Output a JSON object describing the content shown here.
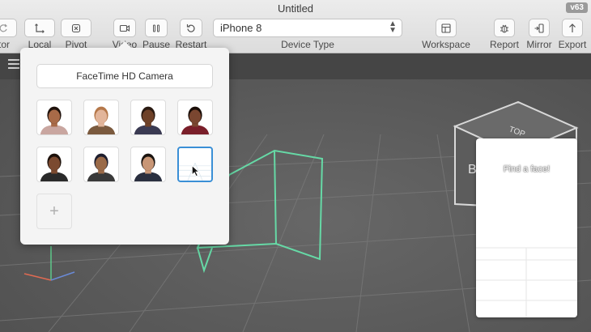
{
  "window": {
    "title": "Untitled",
    "version": "v63"
  },
  "toolbar": {
    "items": [
      {
        "label": "tor",
        "icon": "refresh-icon"
      },
      {
        "label": "Local",
        "icon": "axes-icon"
      },
      {
        "label": "Pivot",
        "icon": "pivot-icon"
      },
      {
        "label": "Video",
        "icon": "video-icon"
      },
      {
        "label": "Pause",
        "icon": "pause-icon"
      },
      {
        "label": "Restart",
        "icon": "restart-icon"
      },
      {
        "label": "Workspace",
        "icon": "workspace-icon"
      },
      {
        "label": "Report",
        "icon": "bug-icon"
      },
      {
        "label": "Mirror",
        "icon": "mirror-icon"
      },
      {
        "label": "Export",
        "icon": "export-icon"
      }
    ],
    "device": {
      "value": "iPhone 8",
      "label": "Device Type"
    }
  },
  "popover": {
    "camera_label": "FaceTime HD Camera",
    "faces": [
      {
        "skin": "#a86a48",
        "hair": "#1f120c",
        "shirt": "#c9a6a0"
      },
      {
        "skin": "#e2b59a",
        "hair": "#b5784a",
        "shirt": "#7b5a3e"
      },
      {
        "skin": "#6e4128",
        "hair": "#2a1a12",
        "shirt": "#3a3a52"
      },
      {
        "skin": "#7a4630",
        "hair": "#1a0e08",
        "shirt": "#7a1f2a"
      },
      {
        "skin": "#7b4a30",
        "hair": "#1c110b",
        "shirt": "#2a2a2a"
      },
      {
        "skin": "#9a6a48",
        "hair": "#1e1e2e",
        "shirt": "#3a3a3a"
      },
      {
        "skin": "#c89676",
        "hair": "#1a1410",
        "shirt": "#2a2f3f"
      }
    ],
    "add_label": "+"
  },
  "preview": {
    "message": "Find a face!"
  },
  "scene": {
    "cube_label": "TOP",
    "cube_side": "B"
  },
  "colors": {
    "accent": "#3a8fd6",
    "frustum": "#66d9a6"
  }
}
